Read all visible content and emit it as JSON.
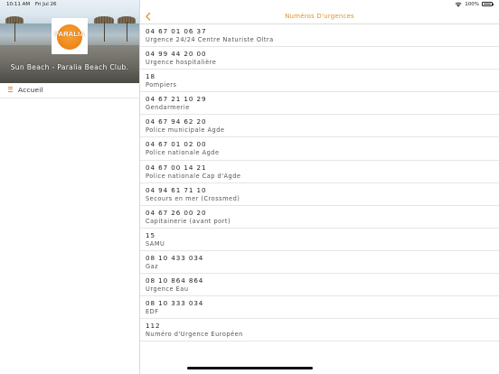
{
  "status_bar": {
    "time": "10:11 AM",
    "date": "Fri Jul 26",
    "battery": "100%",
    "battery_level": 1.0,
    "wifi_icon": "wifi-icon",
    "battery_icon": "battery-icon"
  },
  "sidebar": {
    "logo_text": "PARALIA",
    "caption": "Sun Beach - Paralia Beach Club.",
    "menu": [
      {
        "label": "Accueil",
        "icon": "menu-list-icon"
      }
    ]
  },
  "nav": {
    "title": "Numéros D'urgences",
    "back_icon": "chevron-left-icon",
    "accent_color": "#e0912a"
  },
  "contacts": [
    {
      "number": "04 67 01 06 37",
      "label": "Urgence 24/24 Centre Naturiste Oltra"
    },
    {
      "number": "04 99 44 20 00",
      "label": "Urgence hospitalière"
    },
    {
      "number": "18",
      "label": "Pompiers"
    },
    {
      "number": "04 67 21 10 29",
      "label": "Gendarmerie"
    },
    {
      "number": "04 67 94 62 20",
      "label": "Police municipale Agde"
    },
    {
      "number": "04 67 01 02 00",
      "label": "Police nationale Agde"
    },
    {
      "number": "04 67 00 14 21",
      "label": "Police nationale Cap d'Agde"
    },
    {
      "number": "04 94 61 71 10",
      "label": "Secours en mer (Crossmed)"
    },
    {
      "number": "04 67 26 00 20",
      "label": "Capitainerie (avant port)"
    },
    {
      "number": "15",
      "label": "SAMU"
    },
    {
      "number": "08 10 433 034",
      "label": "Gaz"
    },
    {
      "number": "08 10 864 864",
      "label": "Urgence Eau"
    },
    {
      "number": "08 10 333 034",
      "label": "EDF"
    },
    {
      "number": "112",
      "label": "Numéro d'Urgence Européen"
    }
  ]
}
